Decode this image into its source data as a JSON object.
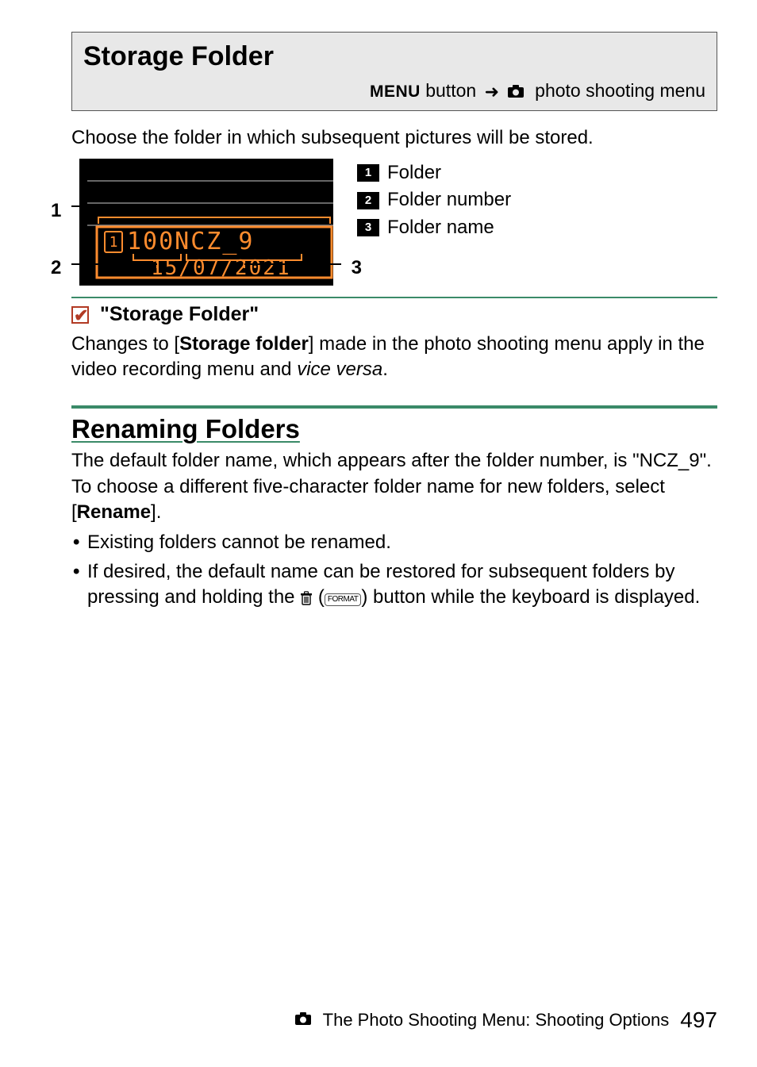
{
  "header": {
    "title": "Storage Folder",
    "menu_button_label": "MENU",
    "menu_button_suffix": " button",
    "breadcrumb_target": "photo shooting menu"
  },
  "intro": "Choose the folder in which subsequent pictures will be stored.",
  "figure": {
    "left_labels": {
      "n1": "1",
      "n2": "2"
    },
    "right_labels": {
      "n3": "3"
    },
    "lcd_line1": "100NCZ_9",
    "lcd_line2": "15/07/2021",
    "legend": [
      {
        "num": "1",
        "label": "Folder"
      },
      {
        "num": "2",
        "label": "Folder number"
      },
      {
        "num": "3",
        "label": "Folder name"
      }
    ]
  },
  "note": {
    "title": "\"Storage Folder\"",
    "body_pre": "Changes to [",
    "body_bold": "Storage folder",
    "body_mid": "] made in the photo shooting menu apply in the video recording menu and ",
    "body_em": "vice versa",
    "body_post": "."
  },
  "section": {
    "title": "Renaming Folders",
    "para_pre": "The default folder name, which appears after the folder number, is \"NCZ_9\". To choose a different five-character folder name for new folders, select [",
    "para_bold": "Rename",
    "para_post": "].",
    "bullets": [
      {
        "text": "Existing folders cannot be renamed."
      },
      {
        "pre": "If desired, the default name can be restored for subsequent folders by pressing and holding the ",
        "format_label": "FORMAT",
        "post": " button while the keyboard is displayed."
      }
    ]
  },
  "footer": {
    "chapter": "The Photo Shooting Menu: Shooting Options",
    "page": "497"
  }
}
